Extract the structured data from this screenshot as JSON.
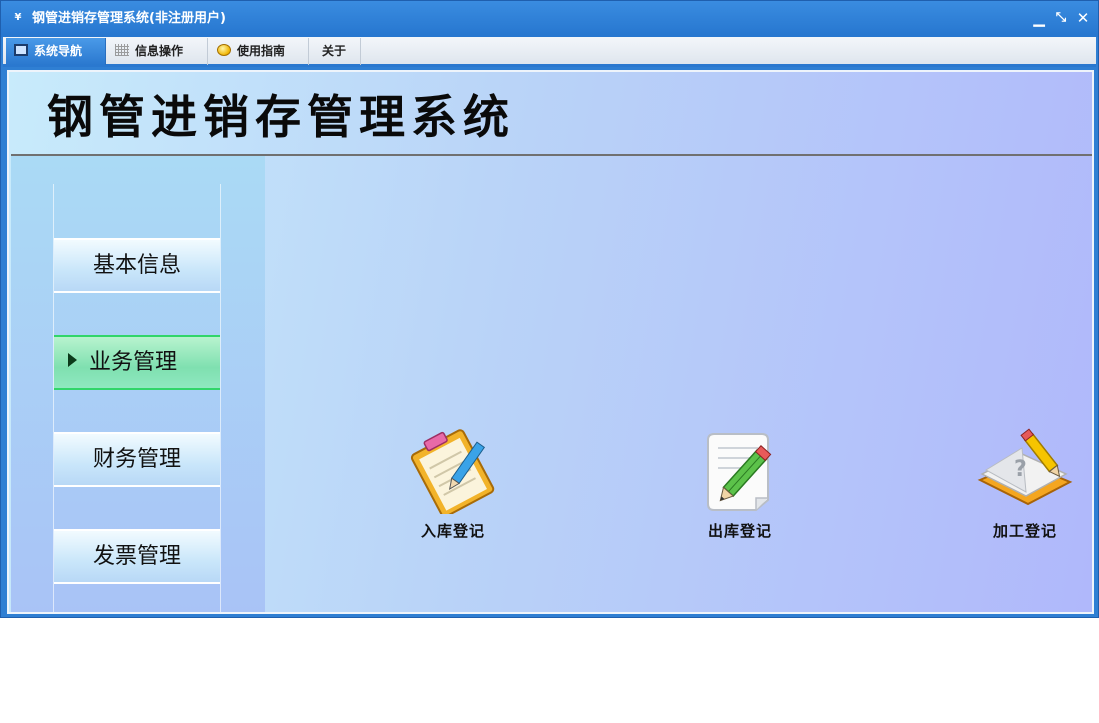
{
  "window": {
    "title": "钢管进销存管理系统(非注册用户)",
    "controls": {
      "minimize": "▁",
      "restore": "⤡",
      "close": "✕"
    }
  },
  "menu": {
    "tabs": [
      {
        "label": "系统导航",
        "icon": "screen-icon",
        "active": true
      },
      {
        "label": "信息操作",
        "icon": "grid-icon",
        "active": false
      },
      {
        "label": "使用指南",
        "icon": "bulb-icon",
        "active": false
      },
      {
        "label": "关于",
        "icon": "",
        "active": false
      }
    ]
  },
  "header": {
    "title": "钢管进销存管理系统"
  },
  "sidebar": {
    "items": [
      {
        "label": "基本信息",
        "active": false
      },
      {
        "label": "业务管理",
        "active": true
      },
      {
        "label": "财务管理",
        "active": false
      },
      {
        "label": "发票管理",
        "active": false
      }
    ]
  },
  "functions": [
    {
      "label": "入库登记",
      "icon": "clipboard-pen-icon"
    },
    {
      "label": "出库登记",
      "icon": "document-pencil-icon"
    },
    {
      "label": "加工登记",
      "icon": "book-pencil-icon"
    }
  ],
  "colors": {
    "titlebar": "#2676cf",
    "active_tab": "#2a78cf",
    "active_sidebar": "#7fe0b0",
    "content_start": "#c8ebfb",
    "content_end": "#b0b8fb"
  }
}
